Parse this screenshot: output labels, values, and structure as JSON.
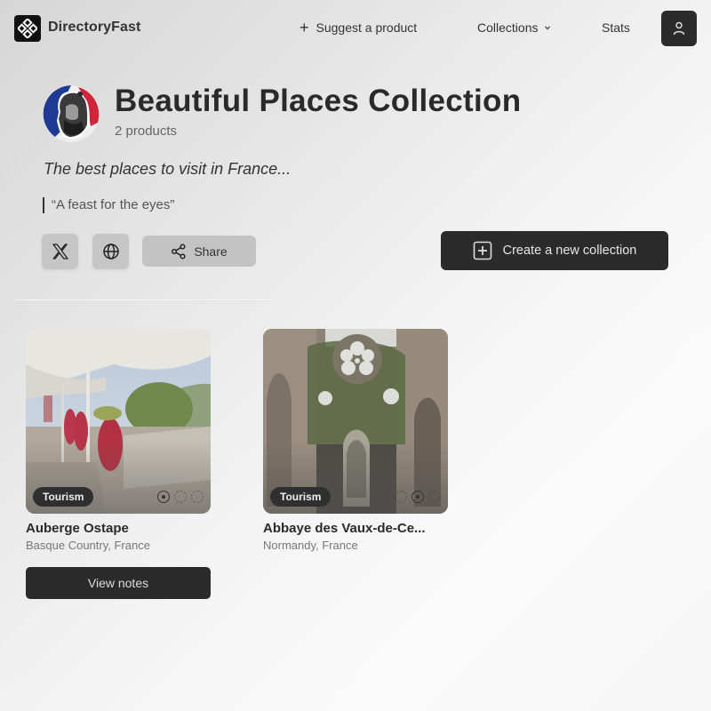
{
  "header": {
    "brand": "DirectoryFast",
    "logo_icon": "diamond-grid-icon",
    "nav": {
      "suggest_label": "Suggest a product",
      "collections_label": "Collections",
      "stats_label": "Stats"
    },
    "user_icon": "user-icon"
  },
  "collection": {
    "title": "Beautiful Places Collection",
    "product_count": "2 products",
    "description": "The best places to visit in France...",
    "quote": "“A feast for the eyes”",
    "share_label": "Share",
    "create_label": "Create a new collection"
  },
  "products": [
    {
      "name": "Auberge Ostape",
      "location": "Basque Country, France",
      "tag": "Tourism",
      "image_count": 3,
      "active_image": 1
    },
    {
      "name": "Abbaye des Vaux-de-Ce...",
      "location": "Normandy, France",
      "tag": "Tourism",
      "image_count": 3,
      "active_image": 2
    }
  ],
  "view_notes_label": "View notes",
  "colors": {
    "dark": "#2b2b2b",
    "flag_blue": "#1f3a93",
    "flag_red": "#d0243b"
  }
}
